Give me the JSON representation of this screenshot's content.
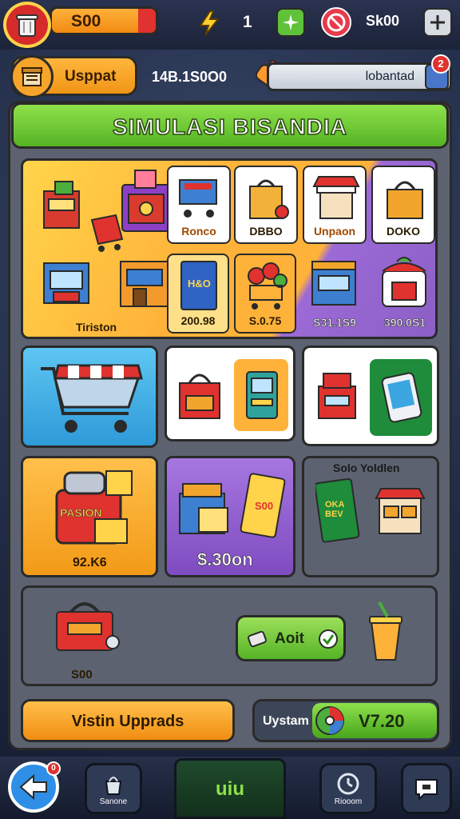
{
  "topbar": {
    "coins": "S00",
    "lightning_count": "1",
    "currency": "Sk00"
  },
  "shop": {
    "button_label": "Usppat",
    "balance": "14B.1S0O0",
    "search_label": "lobantad",
    "notification_badge": "2"
  },
  "title": "SIMULASI BISANDIA",
  "shelf": {
    "items": [
      {
        "label": "Tiriston"
      },
      {
        "label": "Ronco"
      },
      {
        "label": "DBBO"
      },
      {
        "label": "Unpaon"
      },
      {
        "label": "DOKO"
      },
      {
        "label": "200.98"
      },
      {
        "label": "S.0.75"
      },
      {
        "label": "S31.1S9"
      },
      {
        "label": "390.0S1"
      }
    ]
  },
  "cards": {
    "pasion": {
      "sign": "PASION",
      "price": "92.K6"
    },
    "cash": {
      "price": "$.30on",
      "book_text": "S00"
    },
    "solo": {
      "title": "Solo Yoldlen",
      "book_text": "OKA BEV"
    },
    "toolbox": {
      "price": "S00"
    },
    "action_button": "Aoit"
  },
  "footer": {
    "upgrade_button": "Vistin Upprads",
    "system_label": "Uystam",
    "system_value": "V7.20"
  },
  "bottom_nav": {
    "left_badge": "0",
    "items": [
      {
        "label": "Sanone"
      },
      {
        "label": "uiu"
      },
      {
        "label": "Riooom"
      }
    ]
  },
  "colors": {
    "accent_green": "#55b324",
    "accent_orange": "#f09516",
    "accent_purple": "#8b5fc6",
    "accent_red": "#e0322f"
  }
}
